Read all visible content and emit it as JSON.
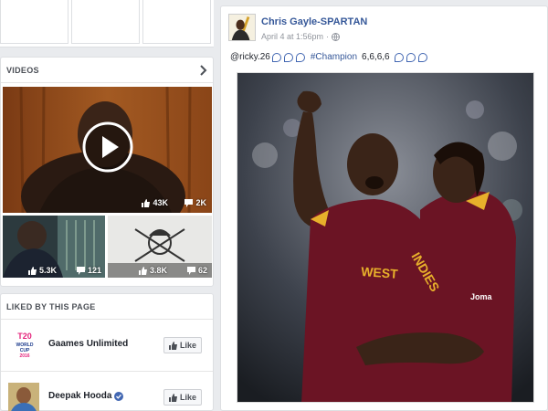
{
  "sections": {
    "videos_title": "VIDEOS",
    "liked_title": "LIKED BY THIS PAGE"
  },
  "videos": {
    "main": {
      "likes": "43K",
      "comments": "2K"
    },
    "thumbs": [
      {
        "likes": "5.3K",
        "comments": "121"
      },
      {
        "likes": "3.8K",
        "comments": "62"
      }
    ]
  },
  "liked_pages": [
    {
      "name": "Gaames Unlimited",
      "like_label": "Like",
      "logo_text": [
        "T20",
        "WORLD",
        "CUP",
        "2016"
      ]
    },
    {
      "name": "Deepak Hooda",
      "like_label": "Like",
      "verified": true
    }
  ],
  "post": {
    "author": "Chris Gayle-SPARTAN",
    "timestamp": "April 4 at 1:56pm",
    "separator": "·",
    "text_mention": "@ricky.26",
    "text_hashtag": "#Champion",
    "text_suffix": "6,6,6,6",
    "jersey_text_left": "WEST",
    "jersey_text_right": "INDIES",
    "jersey_brand": "Joma"
  },
  "colors": {
    "link": "#365899",
    "maroon": "#6b1424",
    "gold": "#e7b02b"
  },
  "icons": [
    "chevron-right-icon",
    "play-icon",
    "thumbs-up-icon",
    "comment-icon",
    "globe-icon",
    "verified-icon"
  ]
}
